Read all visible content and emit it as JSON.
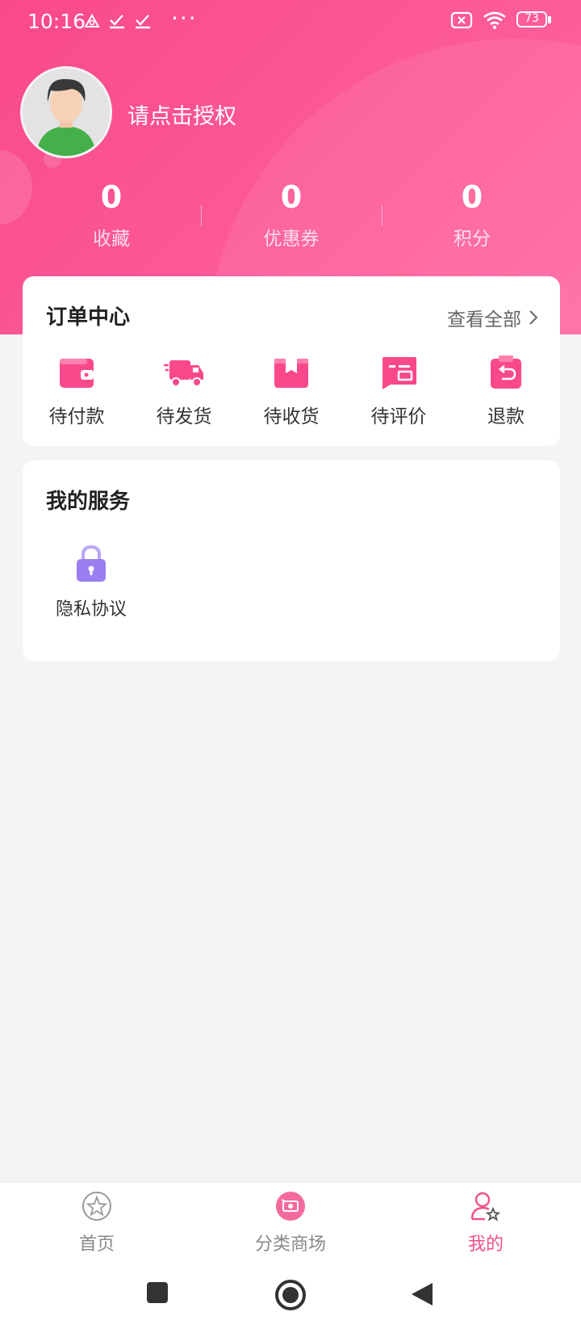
{
  "status_bar": {
    "time": "10:16",
    "battery": "73",
    "more_dots": "···"
  },
  "profile": {
    "auth_prompt": "请点击授权"
  },
  "stats": [
    {
      "value": "0",
      "label": "收藏"
    },
    {
      "value": "0",
      "label": "优惠券"
    },
    {
      "value": "0",
      "label": "积分"
    }
  ],
  "order_center": {
    "title": "订单中心",
    "view_all": "查看全部",
    "items": [
      {
        "label": "待付款",
        "icon": "wallet-icon"
      },
      {
        "label": "待发货",
        "icon": "delivery-truck-icon"
      },
      {
        "label": "待收货",
        "icon": "package-box-icon"
      },
      {
        "label": "待评价",
        "icon": "comment-card-icon"
      },
      {
        "label": "退款",
        "icon": "refund-clipboard-icon"
      }
    ]
  },
  "services": {
    "title": "我的服务",
    "items": [
      {
        "label": "隐私协议",
        "icon": "lock-icon"
      }
    ]
  },
  "tabbar": {
    "tabs": [
      {
        "label": "首页",
        "icon": "star-circle-icon",
        "active": false
      },
      {
        "label": "分类商场",
        "icon": "shopping-basket-icon",
        "active": false
      },
      {
        "label": "我的",
        "icon": "user-star-icon",
        "active": true
      }
    ]
  },
  "colors": {
    "brand_pink": "#f9498a",
    "tab_active": "#f0508c",
    "lock_purple": "#9b7ef0"
  }
}
